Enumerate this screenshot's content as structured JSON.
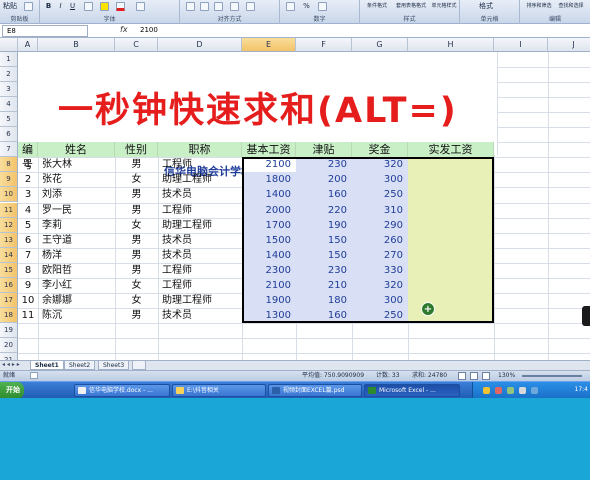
{
  "ribbon": {
    "groups": [
      {
        "label": "剪贴板"
      },
      {
        "label": "字体"
      },
      {
        "label": "对齐方式"
      },
      {
        "label": "数字"
      },
      {
        "label": "样式"
      },
      {
        "label": "单元格"
      },
      {
        "label": "编辑"
      }
    ],
    "buttons": {
      "paste": "粘贴",
      "bold": "B",
      "italic": "I",
      "underline": "U",
      "percent": "%",
      "conditional_format": "条件格式",
      "table_format": "套用表格格式",
      "cell_style": "单元格样式",
      "format": "格式",
      "sort_filter": "排序和筛选",
      "find_select": "查找和选择"
    }
  },
  "formula_bar": {
    "name_box": "E8",
    "fx": "fx",
    "value": "2100"
  },
  "columns": [
    "A",
    "B",
    "C",
    "D",
    "E",
    "F",
    "G",
    "H",
    "I",
    "J"
  ],
  "rows": [
    "1",
    "2",
    "3",
    "4",
    "5",
    "6",
    "7",
    "8",
    "9",
    "10",
    "11",
    "12",
    "13",
    "14",
    "15",
    "16",
    "17",
    "18",
    "19",
    "20",
    "21"
  ],
  "banner_title": "一秒钟快速求和(ALT=)",
  "subtitle": "信华电脑会计学校　工资表",
  "table": {
    "headers": [
      "编号",
      "姓名",
      "性别",
      "职称",
      "基本工资",
      "津贴",
      "奖金",
      "实发工资"
    ],
    "rows": [
      {
        "id": "1",
        "name": "张大林",
        "gender": "男",
        "title": "工程师",
        "base": "2100",
        "allowance": "230",
        "bonus": "320"
      },
      {
        "id": "2",
        "name": "张花",
        "gender": "女",
        "title": "助理工程师",
        "base": "1800",
        "allowance": "200",
        "bonus": "300"
      },
      {
        "id": "3",
        "name": "刘添",
        "gender": "男",
        "title": "技术员",
        "base": "1400",
        "allowance": "160",
        "bonus": "250"
      },
      {
        "id": "4",
        "name": "罗一民",
        "gender": "男",
        "title": "工程师",
        "base": "2000",
        "allowance": "220",
        "bonus": "310"
      },
      {
        "id": "5",
        "name": "李莉",
        "gender": "女",
        "title": "助理工程师",
        "base": "1700",
        "allowance": "190",
        "bonus": "290"
      },
      {
        "id": "6",
        "name": "王守道",
        "gender": "男",
        "title": "技术员",
        "base": "1500",
        "allowance": "150",
        "bonus": "260"
      },
      {
        "id": "7",
        "name": "杨洋",
        "gender": "男",
        "title": "技术员",
        "base": "1400",
        "allowance": "150",
        "bonus": "270"
      },
      {
        "id": "8",
        "name": "欧阳哲",
        "gender": "男",
        "title": "工程师",
        "base": "2300",
        "allowance": "230",
        "bonus": "330"
      },
      {
        "id": "9",
        "name": "李小红",
        "gender": "女",
        "title": "工程师",
        "base": "2100",
        "allowance": "210",
        "bonus": "320"
      },
      {
        "id": "10",
        "name": "余娜娜",
        "gender": "女",
        "title": "助理工程师",
        "base": "1900",
        "allowance": "180",
        "bonus": "300"
      },
      {
        "id": "11",
        "name": "陈沉",
        "gender": "男",
        "title": "技术员",
        "base": "1300",
        "allowance": "160",
        "bonus": "250"
      }
    ]
  },
  "sheet_tabs": [
    "Sheet1",
    "Sheet2",
    "Sheet3"
  ],
  "status_bar": {
    "mode": "就绪",
    "average": "平均值: 750.9090909",
    "count": "计数: 33",
    "sum": "求和: 24780",
    "zoom": "130%"
  },
  "taskbar": {
    "start": "开始",
    "tasks": [
      "信华电脑学校.docx - ...",
      "E:\\抖音相关",
      "视频封面EXCEL篇.psd",
      "Microsoft Excel - ..."
    ],
    "clock": "17:4"
  }
}
